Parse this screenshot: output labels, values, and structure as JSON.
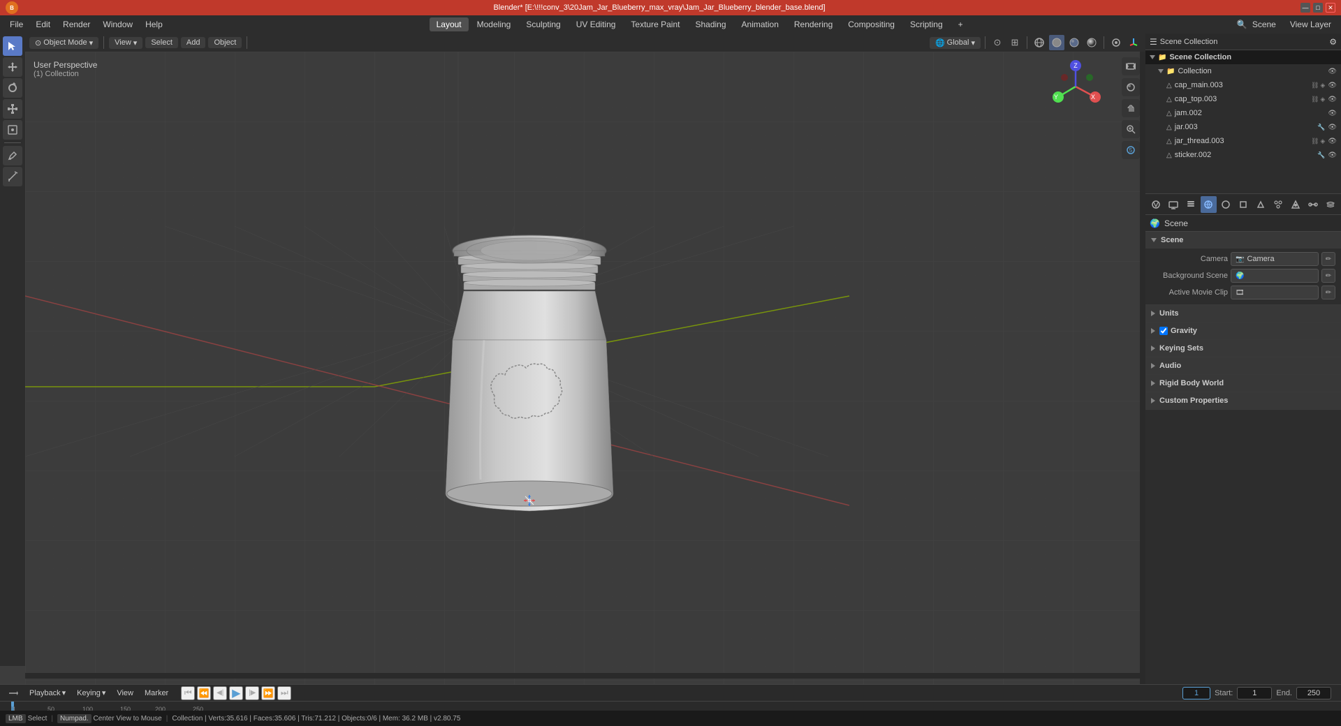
{
  "titlebar": {
    "title": "Blender* [E:\\!!!conv_3\\20Jam_Jar_Blueberry_max_vray\\Jam_Jar_Blueberry_blender_base.blend]",
    "workspace": "View Layer",
    "controls": {
      "minimize": "—",
      "maximize": "□",
      "close": "✕"
    }
  },
  "menubar": {
    "left": [
      "Blender",
      "File",
      "Edit",
      "Render",
      "Window",
      "Help"
    ],
    "workspaces": [
      "Layout",
      "Modeling",
      "Sculpting",
      "UV Editing",
      "Texture Paint",
      "Shading",
      "Animation",
      "Rendering",
      "Compositing",
      "Scripting"
    ],
    "active_workspace": "Layout",
    "add_tab": "+"
  },
  "viewport_header": {
    "mode": "Object Mode",
    "viewport_shading": "View",
    "select": "Select",
    "add": "Add",
    "object": "Object",
    "transform_global": "Global",
    "pivot": "⊙",
    "snapping": "⊞",
    "proportional": "○"
  },
  "viewport": {
    "label_top": "User Perspective",
    "label_bottom": "(1) Collection",
    "nav_icons": [
      "⟳",
      "⌖",
      "✋",
      "🔍",
      "⚙"
    ]
  },
  "outliner": {
    "title": "Scene Collection",
    "items": [
      {
        "name": "Collection",
        "type": "collection",
        "indent": 0,
        "expanded": true,
        "visible": true
      },
      {
        "name": "cap_main.003",
        "type": "mesh",
        "indent": 1,
        "visible": true
      },
      {
        "name": "cap_top.003",
        "type": "mesh",
        "indent": 1,
        "visible": true
      },
      {
        "name": "jam.002",
        "type": "mesh",
        "indent": 1,
        "visible": true
      },
      {
        "name": "jar.003",
        "type": "mesh",
        "indent": 1,
        "visible": true
      },
      {
        "name": "jar_thread.003",
        "type": "mesh",
        "indent": 1,
        "visible": true
      },
      {
        "name": "sticker.002",
        "type": "mesh",
        "indent": 1,
        "visible": true
      }
    ]
  },
  "properties_icons": {
    "icons": [
      "🎬",
      "🖼",
      "📷",
      "🌍",
      "🎭",
      "📦",
      "✏",
      "⚙",
      "⚡",
      "🌊",
      "👁"
    ]
  },
  "scene_properties": {
    "title": "Scene",
    "label": "Scene",
    "sections": [
      {
        "name": "Scene",
        "expanded": true,
        "rows": [
          {
            "label": "Camera",
            "value": "Camera",
            "has_edit": true
          },
          {
            "label": "Background Scene",
            "value": "",
            "has_edit": true
          },
          {
            "label": "Active Movie Clip",
            "value": "",
            "has_edit": true
          }
        ]
      },
      {
        "name": "Units",
        "expanded": false,
        "rows": []
      },
      {
        "name": "Gravity",
        "expanded": false,
        "checkbox": true,
        "rows": []
      },
      {
        "name": "Keying Sets",
        "expanded": false,
        "rows": []
      },
      {
        "name": "Audio",
        "expanded": false,
        "rows": []
      },
      {
        "name": "Rigid Body World",
        "expanded": false,
        "rows": []
      },
      {
        "name": "Custom Properties",
        "expanded": false,
        "rows": []
      }
    ]
  },
  "timeline": {
    "tabs": [
      "Playback",
      "Keying",
      "View",
      "Marker"
    ],
    "controls": {
      "jump_start": "⏮",
      "step_back": "⏪",
      "prev_keyframe": "◀",
      "play": "▶",
      "next_keyframe": "▶",
      "step_forward": "⏩",
      "jump_end": "⏭"
    },
    "current_frame": "1",
    "start_frame": "1",
    "end_frame": "250",
    "frame_numbers": [
      1,
      50,
      100,
      150,
      200,
      250
    ],
    "markers": [
      0,
      44,
      85,
      131,
      177,
      225,
      269,
      314,
      360,
      406,
      452,
      498,
      544,
      591,
      637,
      683,
      729,
      775,
      821,
      867,
      913,
      960,
      1006,
      1052,
      1098
    ]
  },
  "statusbar": {
    "select_key": "Select",
    "center_key": "Center View to Mouse",
    "collection_info": "Collection | Verts:35.616 | Faces:35.606 | Tris:71.212 | Objects:0/6 | Mem: 36.2 MB | v2.80.75"
  }
}
